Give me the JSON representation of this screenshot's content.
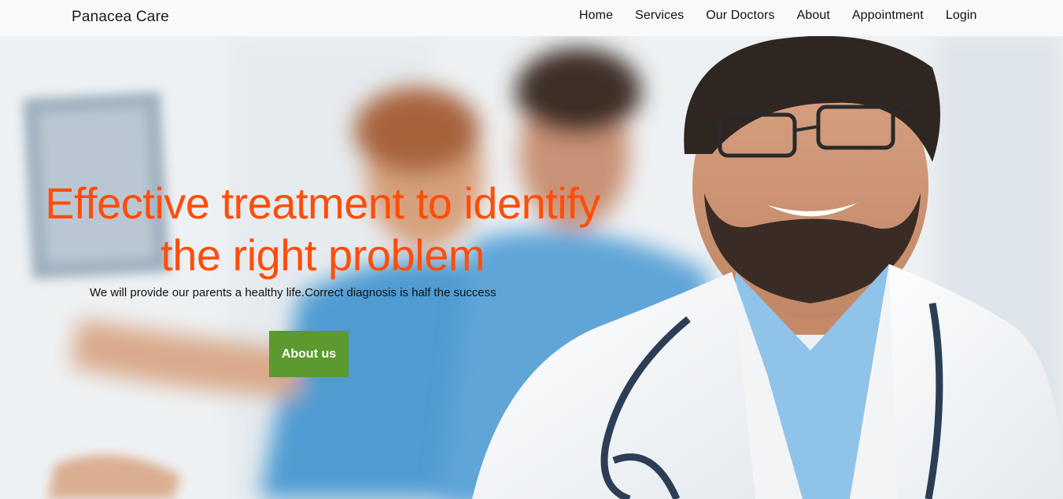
{
  "nav": {
    "brand": "Panacea Care",
    "links": [
      "Home",
      "Services",
      "Our Doctors",
      "About",
      "Appointment",
      "Login"
    ]
  },
  "hero": {
    "title": "Effective treatment to identify the right problem",
    "subtitle": "We will provide our parents a healthy life.Correct diagnosis is half the success",
    "button_label": "About us"
  },
  "colors": {
    "title": "#ff4d0a",
    "button": "#5a9a2f",
    "navbar": "#f8f9fb"
  }
}
